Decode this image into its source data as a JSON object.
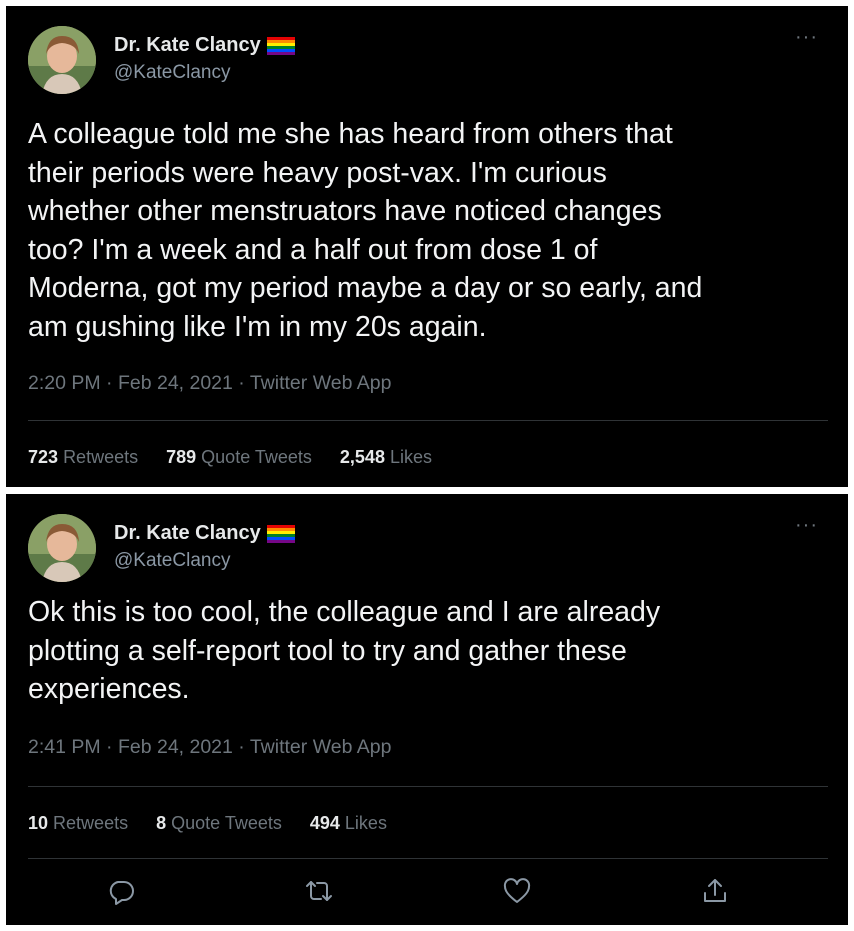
{
  "tweets": [
    {
      "author": {
        "name": "Dr. Kate Clancy",
        "handle": "@KateClancy",
        "flag_icon": "rainbow-flag-icon"
      },
      "more_icon": "more-icon",
      "more_label": "···",
      "text": "A colleague told me she has heard from others that\ntheir periods were heavy post-vax. I'm curious\nwhether other menstruators have noticed changes\ntoo? I'm a week and a half out from dose 1 of\nModerna, got my period maybe a day or so early, and\nam gushing like I'm in my 20s again.",
      "meta": "2:20 PM · Feb 24, 2021 · Twitter Web App",
      "stats": {
        "retweets": {
          "count": "723",
          "label": "Retweets"
        },
        "quotes": {
          "count": "789",
          "label": "Quote Tweets"
        },
        "likes": {
          "count": "2,548",
          "label": "Likes"
        }
      }
    },
    {
      "author": {
        "name": "Dr. Kate Clancy",
        "handle": "@KateClancy",
        "flag_icon": "rainbow-flag-icon"
      },
      "more_icon": "more-icon",
      "more_label": "···",
      "text": "Ok this is too cool, the colleague and I are already\nplotting a self-report tool to try and gather these\nexperiences.",
      "meta": "2:41 PM · Feb 24, 2021 · Twitter Web App",
      "stats": {
        "retweets": {
          "count": "10",
          "label": "Retweets"
        },
        "quotes": {
          "count": "8",
          "label": "Quote Tweets"
        },
        "likes": {
          "count": "494",
          "label": "Likes"
        }
      },
      "actions": [
        "reply-icon",
        "retweet-icon",
        "like-icon",
        "share-icon"
      ]
    }
  ],
  "colors": {
    "background": "#000000",
    "text": "#e7e9ea",
    "secondary": "#6e767d",
    "divider": "#2f3336",
    "flag": [
      "#e40303",
      "#ff8c00",
      "#ffed00",
      "#008026",
      "#004dff",
      "#750787"
    ]
  }
}
